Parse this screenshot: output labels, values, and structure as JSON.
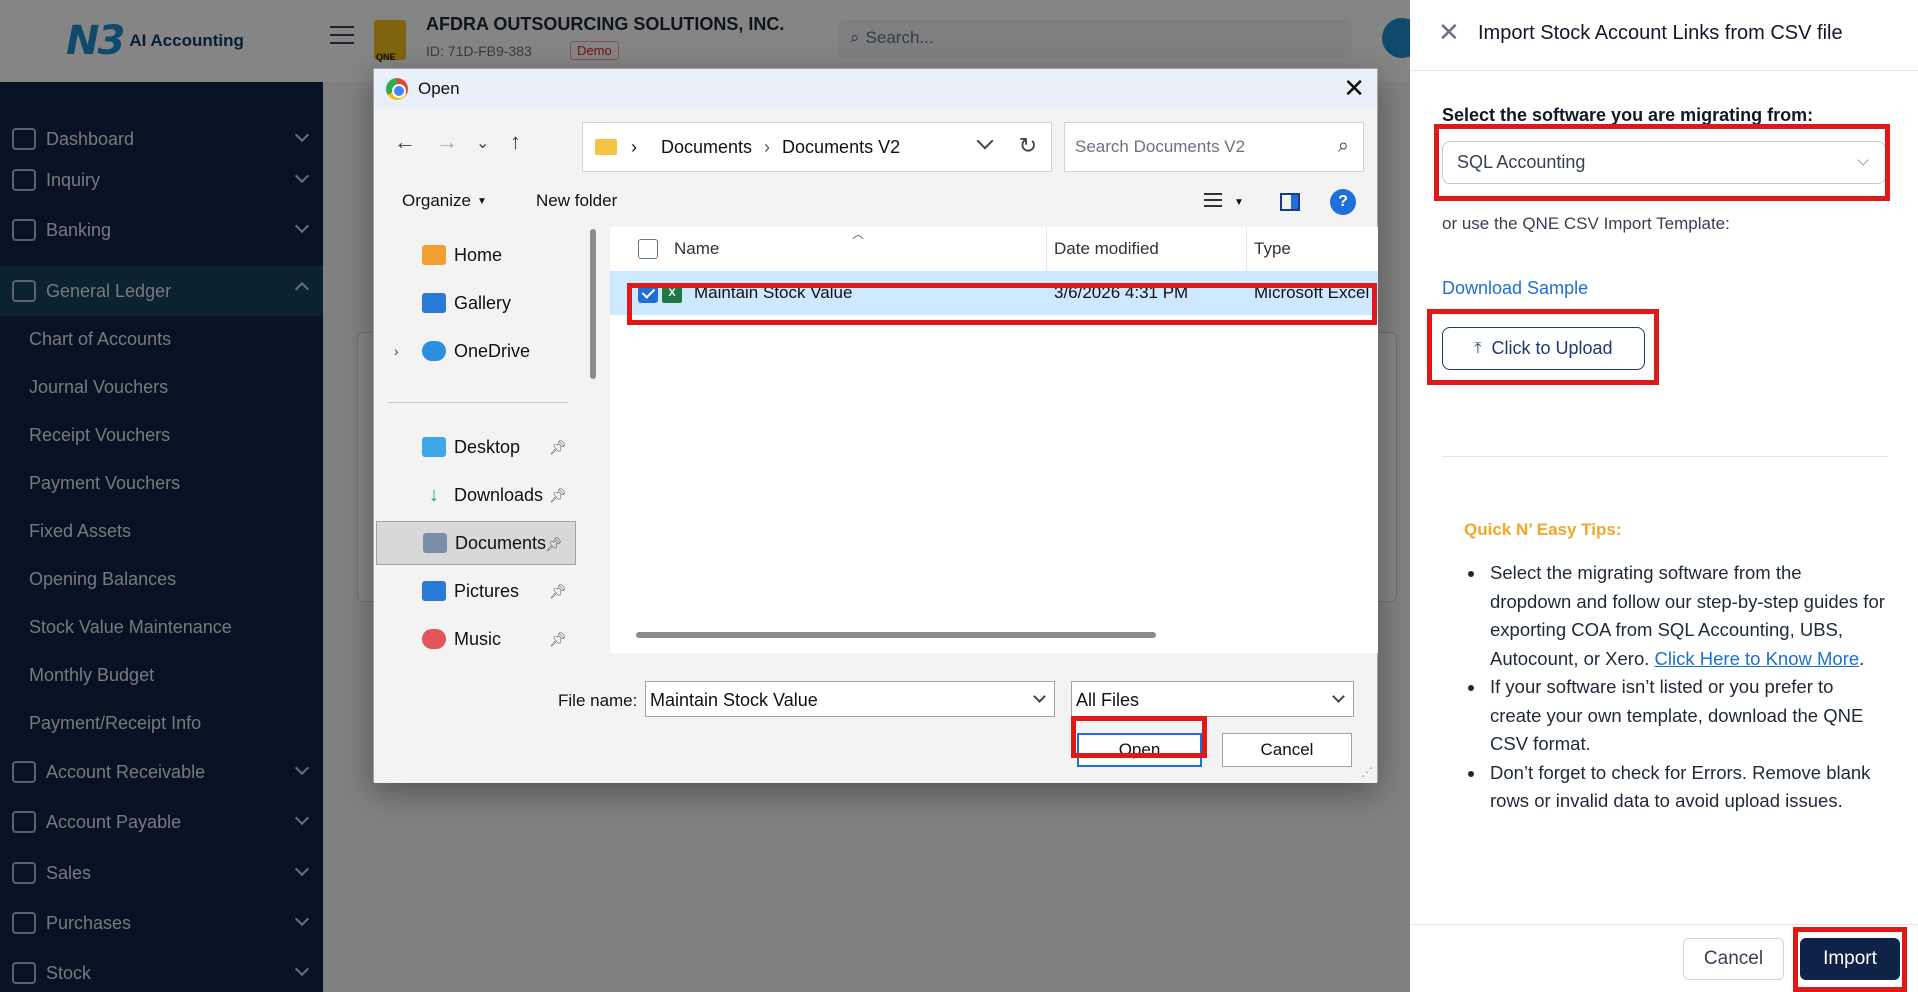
{
  "app": {
    "logo_mark": "N3",
    "logo_text": "AI Accounting",
    "company_name": "AFDRA OUTSOURCING SOLUTIONS, INC.",
    "company_id": "ID: 71D-FB9-383",
    "demo_badge": "Demo",
    "search_placeholder": "Search..."
  },
  "sidebar": {
    "items": [
      {
        "label": "Dashboard"
      },
      {
        "label": "Inquiry"
      },
      {
        "label": "Banking"
      },
      {
        "label": "General Ledger"
      },
      {
        "label": "Account Receivable"
      },
      {
        "label": "Account Payable"
      },
      {
        "label": "Sales"
      },
      {
        "label": "Purchases"
      },
      {
        "label": "Stock"
      }
    ],
    "gl_subitems": [
      "Chart of Accounts",
      "Journal Vouchers",
      "Receipt Vouchers",
      "Payment Vouchers",
      "Fixed Assets",
      "Opening Balances",
      "Stock Value Maintenance",
      "Monthly Budget",
      "Payment/Receipt Info"
    ]
  },
  "dialog": {
    "title": "Open",
    "breadcrumb": [
      "Documents",
      "Documents V2"
    ],
    "search_placeholder": "Search Documents V2",
    "organize": "Organize",
    "new_folder": "New folder",
    "nav_tree": [
      {
        "label": "Home",
        "icon": "home-icon"
      },
      {
        "label": "Gallery",
        "icon": "gallery-icon"
      },
      {
        "label": "OneDrive",
        "icon": "onedrive-icon"
      },
      {
        "label": "Desktop",
        "icon": "desktop-icon"
      },
      {
        "label": "Downloads",
        "icon": "downloads-icon"
      },
      {
        "label": "Documents",
        "icon": "documents-icon"
      },
      {
        "label": "Pictures",
        "icon": "pictures-icon"
      },
      {
        "label": "Music",
        "icon": "music-icon"
      }
    ],
    "columns": {
      "name": "Name",
      "date": "Date modified",
      "type": "Type"
    },
    "files": [
      {
        "name": "Maintain Stock Value",
        "date": "3/6/2026 4:31 PM",
        "type": "Microsoft Excel"
      }
    ],
    "file_name_label": "File name:",
    "file_name_value": "Maintain Stock Value",
    "file_type": "All Files",
    "open_label": "Open",
    "cancel_label": "Cancel"
  },
  "panel": {
    "title": "Import Stock Account Links from CSV file",
    "select_label": "Select the software you are migrating from:",
    "selected_software": "SQL Accounting",
    "or_text": "or use the QNE CSV Import Template:",
    "download_link": "Download Sample",
    "upload_label": "Click to Upload",
    "tips_title": "Quick N’ Easy Tips:",
    "tip1_text": "Select the migrating software from the dropdown and follow our step-by-step guides for exporting COA from SQL Accounting, UBS, Autocount, or Xero.",
    "tip1_link": "Click Here to Know More",
    "tip2_text": "If your software isn’t listed or you prefer to create your own template, download the QNE CSV format.",
    "tip3_text": "Don’t forget to check for Errors. Remove blank rows or invalid data to avoid upload issues.",
    "cancel_label": "Cancel",
    "import_label": "Import"
  },
  "colors": {
    "sidebar_bg": "#0e2347",
    "accent_blue": "#1d6fd1",
    "tips_orange": "#f5a623",
    "highlight_red": "#e01818"
  }
}
